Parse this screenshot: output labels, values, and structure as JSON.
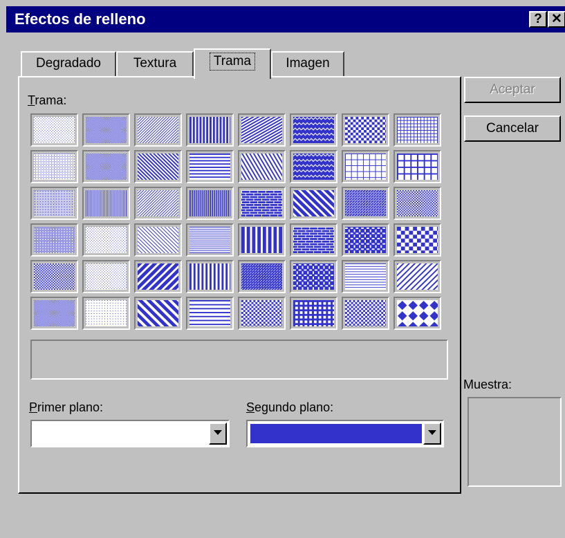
{
  "window": {
    "title": "Efectos de relleno",
    "help_label": "?",
    "close_label": "✕"
  },
  "tabs": [
    {
      "label": "Degradado",
      "active": false
    },
    {
      "label": "Textura",
      "active": false
    },
    {
      "label": "Trama",
      "active": true
    },
    {
      "label": "Imagen",
      "active": false
    }
  ],
  "trama": {
    "label_mnemonic": "T",
    "label_rest": "rama:",
    "rows": 6,
    "cols": 8,
    "selected_index": null,
    "description": ""
  },
  "foreground": {
    "label_mnemonic": "P",
    "label_rest": "rimer plano:",
    "color": "#ffffff"
  },
  "background": {
    "label_mnemonic": "S",
    "label_rest": "egundo plano:",
    "color": "#3333cc"
  },
  "buttons": {
    "accept_label": "Aceptar",
    "cancel_label": "Cancelar"
  },
  "preview": {
    "label": "Muestra:"
  },
  "colors": {
    "title_bar": "#000080",
    "face": "#c0c0c0",
    "pattern_fg": "#3333cc",
    "pattern_bg": "#ffffff"
  }
}
